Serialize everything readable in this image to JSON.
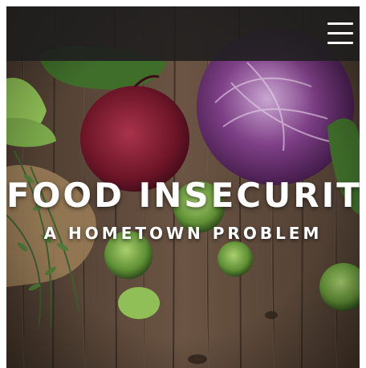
{
  "header": {
    "menu_icon": "hamburger-menu-icon"
  },
  "hero": {
    "title": "FOOD INSECURITY",
    "subtitle": "A HOMETOWN PROBLEM"
  },
  "colors": {
    "header_bg": "#1e1e1e",
    "text": "#ffffff",
    "wood": "#5a4636"
  }
}
